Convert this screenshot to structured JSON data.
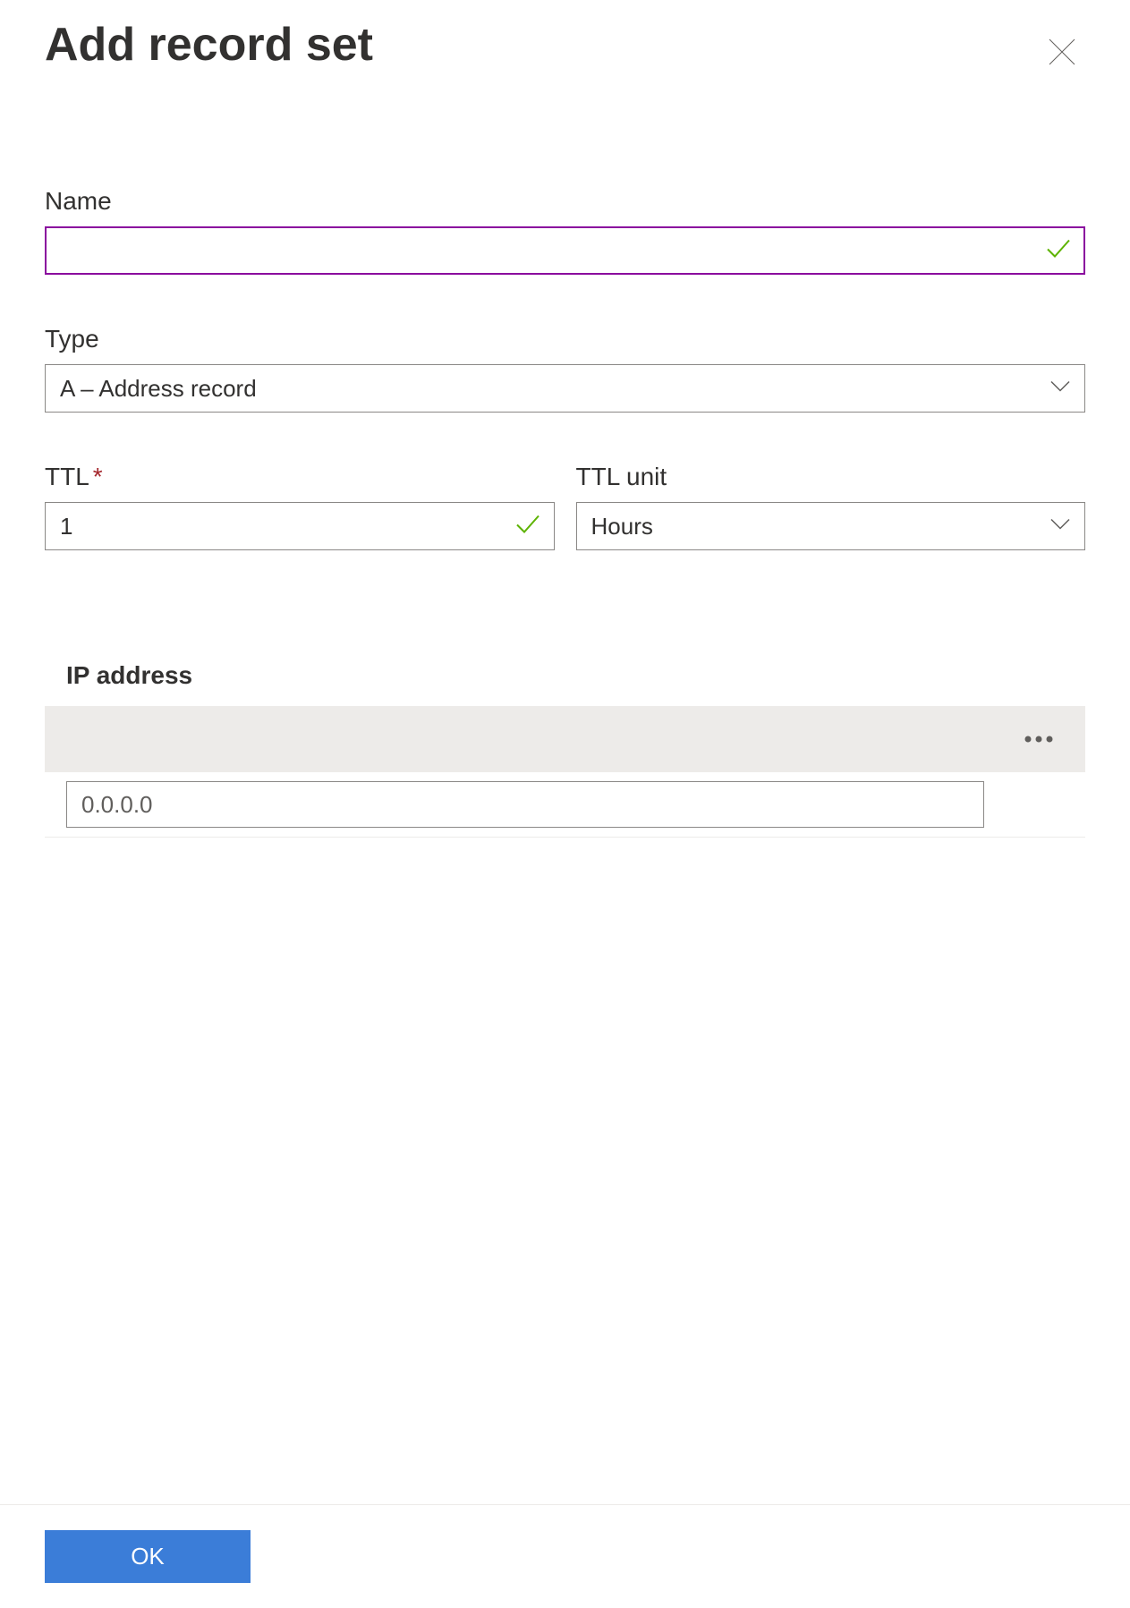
{
  "header": {
    "title": "Add record set"
  },
  "fields": {
    "name": {
      "label": "Name",
      "value": ""
    },
    "type": {
      "label": "Type",
      "value": "A – Address record"
    },
    "ttl": {
      "label": "TTL",
      "value": "1"
    },
    "ttl_unit": {
      "label": "TTL unit",
      "value": "Hours"
    },
    "ip_address": {
      "label": "IP address",
      "placeholder": "0.0.0.0"
    }
  },
  "footer": {
    "ok_label": "OK"
  }
}
